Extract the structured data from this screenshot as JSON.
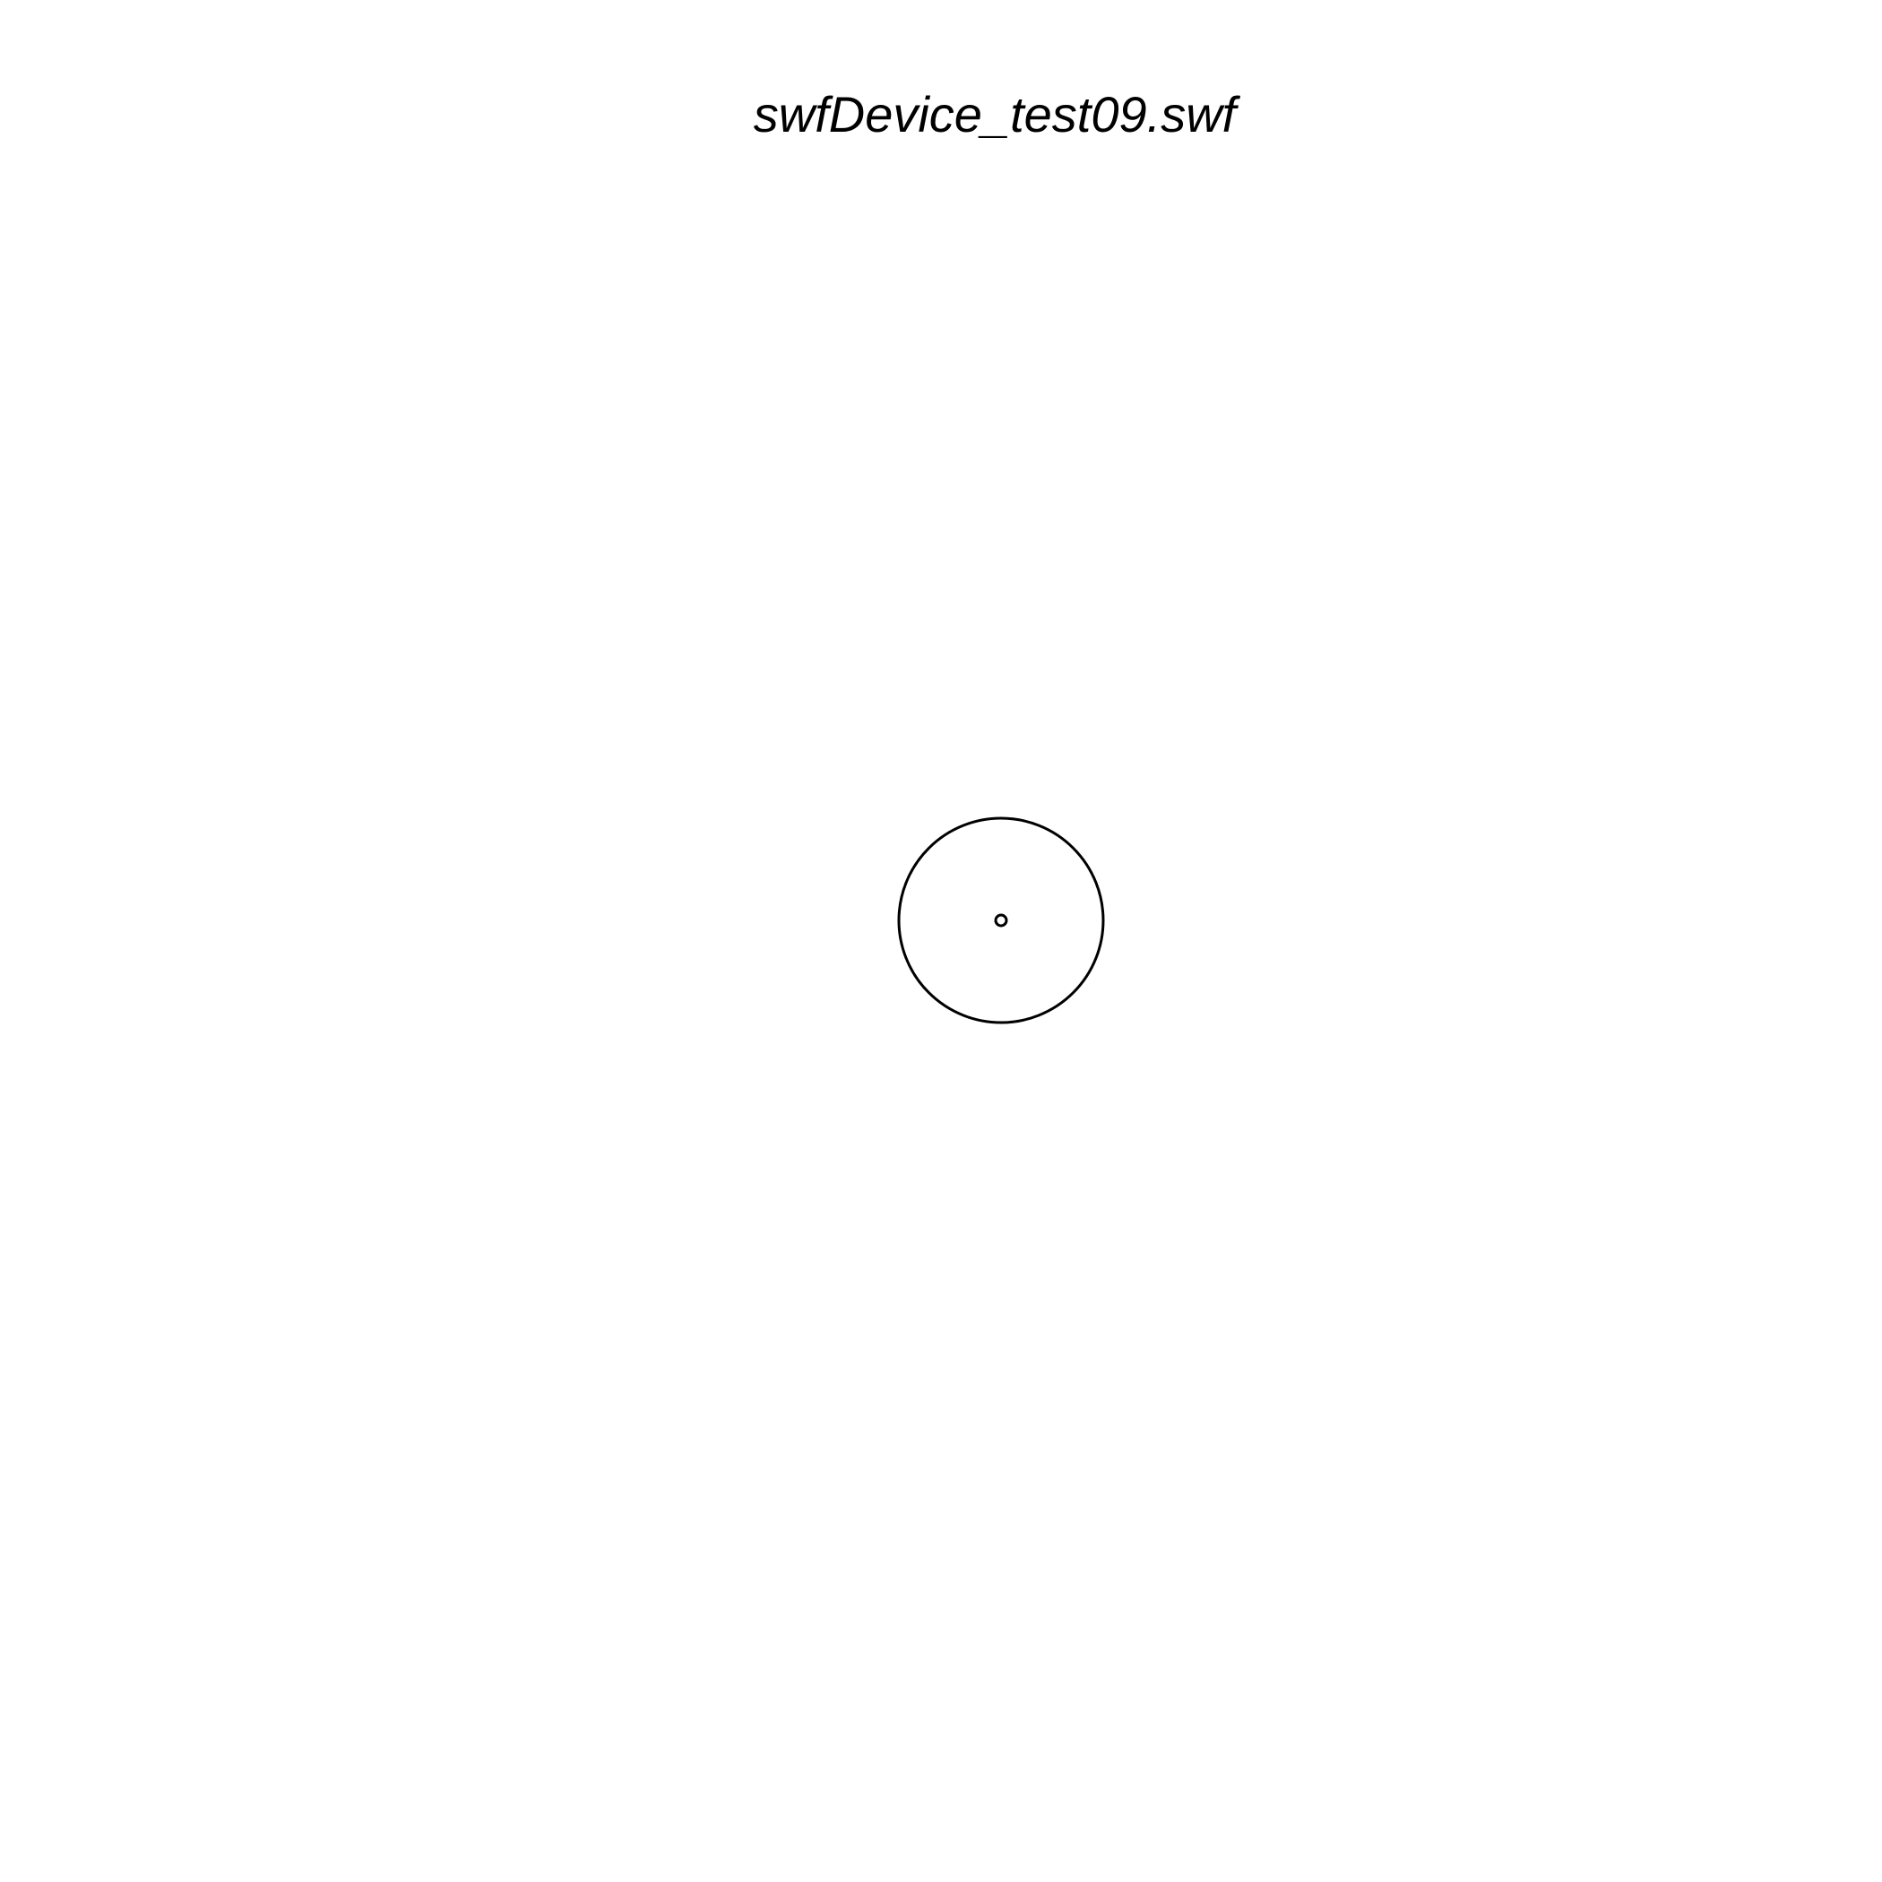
{
  "title": "swfDevice_test09.swf",
  "colors": {
    "background": "#ffffff",
    "stroke": "#000000"
  }
}
